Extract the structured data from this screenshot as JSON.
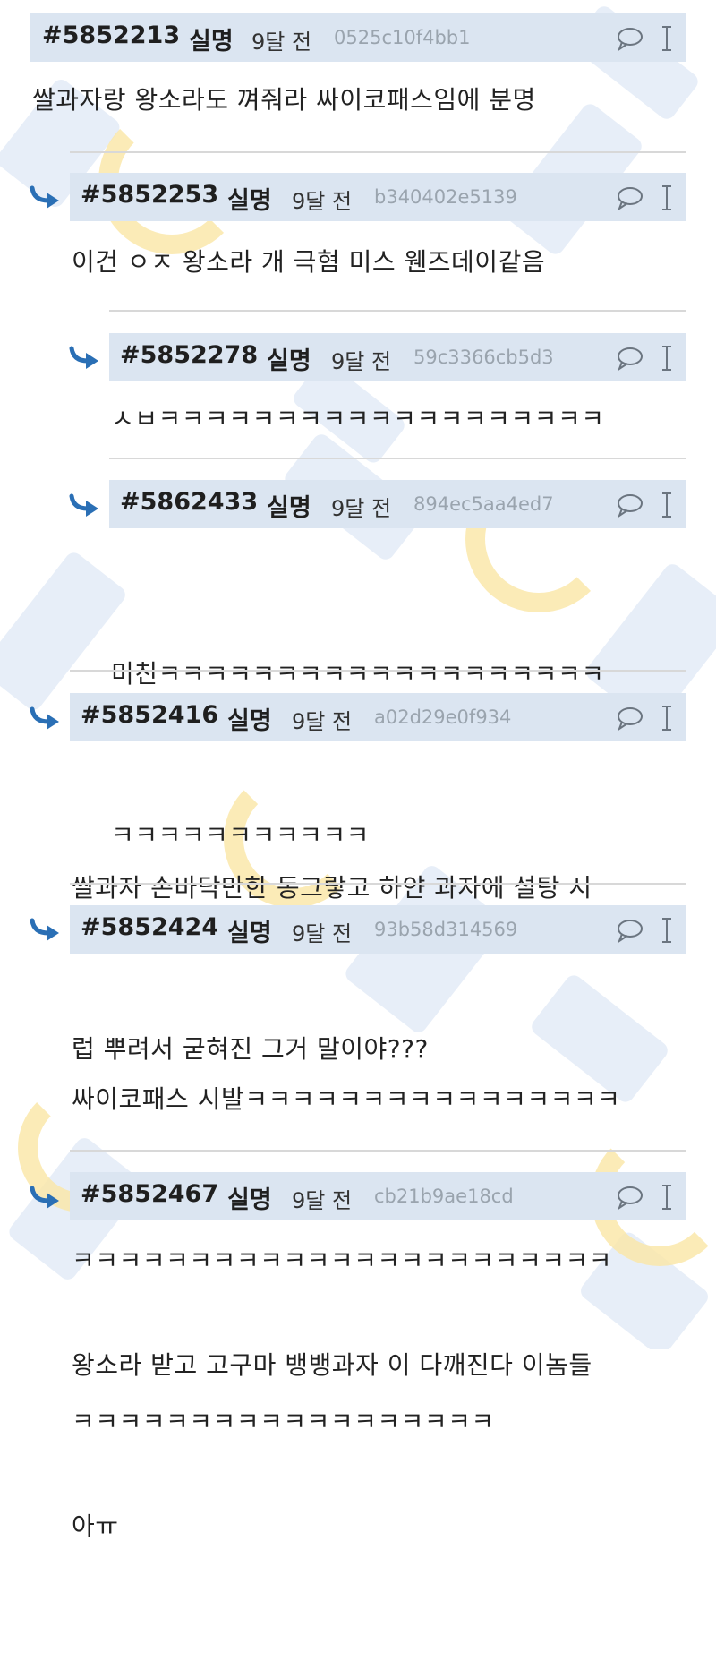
{
  "comments": [
    {
      "number": "#5852213",
      "author": "실명",
      "time": "9달 전",
      "hash": "0525c10f4bb1",
      "lines": [
        "쌀과자랑 왕소라도 껴줘라 싸이코패스임에 분명"
      ]
    },
    {
      "number": "#5852253",
      "author": "실명",
      "time": "9달 전",
      "hash": "b340402e5139",
      "lines": [
        "이건 ㅇㅈ 왕소라 개 극혐 미스 웬즈데이같음"
      ]
    },
    {
      "number": "#5852278",
      "author": "실명",
      "time": "9달 전",
      "hash": "59c3366cb5d3",
      "lines": [
        "ㅅㅂㅋㅋㅋㅋㅋㅋㅋㅋㅋㅋㅋㅋㅋㅋㅋㅋㅋㅋㅋ"
      ]
    },
    {
      "number": "#5862433",
      "author": "실명",
      "time": "9달 전",
      "hash": "894ec5aa4ed7",
      "lines": [
        "미친ㅋㅋㅋㅋㅋㅋㅋㅋㅋㅋㅋㅋㅋㅋㅋㅋㅋㅋㅋ",
        "ㅋㅋㅋㅋㅋㅋㅋㅋㅋㅋㅋ"
      ]
    },
    {
      "number": "#5852416",
      "author": "실명",
      "time": "9달 전",
      "hash": "a02d29e0f934",
      "lines": [
        "쌀과자 손바닥만한 동그랗고 하얀 과자에 설탕 시",
        "럽 뿌려서 굳혀진 그거 말이야???"
      ]
    },
    {
      "number": "#5852424",
      "author": "실명",
      "time": "9달 전",
      "hash": "93b58d314569",
      "lines": [
        "싸이코패스 시발ㅋㅋㅋㅋㅋㅋㅋㅋㅋㅋㅋㅋㅋㅋㅋㅋ",
        "ㅋㅋㅋㅋㅋㅋㅋㅋㅋㅋㅋㅋㅋㅋㅋㅋㅋㅋㅋㅋㅋㅋㅋ",
        "ㅋㅋㅋㅋㅋㅋㅋㅋㅋㅋㅋㅋㅋㅋㅋㅋㅋㅋ"
      ]
    },
    {
      "number": "#5852467",
      "author": "실명",
      "time": "9달 전",
      "hash": "cb21b9ae18cd",
      "lines": [
        "왕소라 받고 고구마 뱅뱅과자 이 다깨진다 이놈들",
        "아ㅠ"
      ]
    }
  ],
  "icons": {
    "comment": "speech-bubble-icon",
    "text_cursor": "text-cursor-icon",
    "reply": "reply-arrow-icon"
  },
  "colors": {
    "header_bg": "#dbe5f1",
    "reply_arrow": "#2a6fb5",
    "hash_text": "#9aa4ae"
  }
}
